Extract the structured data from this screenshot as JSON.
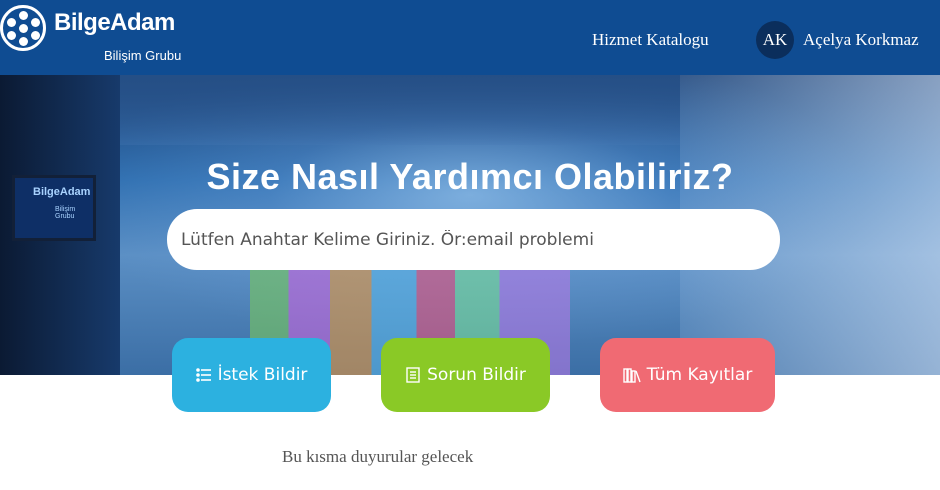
{
  "brand": {
    "name": "BilgeAdam",
    "subtitle": "Bilişim Grubu",
    "logo_icon": "film-reel-icon"
  },
  "nav": {
    "catalog_label": "Hizmet Katalogu",
    "user_initials": "AK",
    "user_name": "Açelya Korkmaz"
  },
  "hero": {
    "title": "Size Nasıl Yardımcı Olabiliriz?",
    "search_placeholder": "Lütfen Anahtar Kelime Giriniz. Ör:email problemi",
    "sign_text": "BilgeAdam",
    "sign_sub": "Bilişim Grubu"
  },
  "actions": [
    {
      "label": "İstek Bildir",
      "icon": "list-icon",
      "color": "#2cb1e0"
    },
    {
      "label": "Sorun Bildir",
      "icon": "document-icon",
      "color": "#8ac926"
    },
    {
      "label": "Tüm Kayıtlar",
      "icon": "books-icon",
      "color": "#f06a73"
    }
  ],
  "announcement": "Bu kısma duyurular gelecek",
  "colors": {
    "header_bg": "#0f4c92",
    "avatar_bg": "#0b2e5c"
  }
}
